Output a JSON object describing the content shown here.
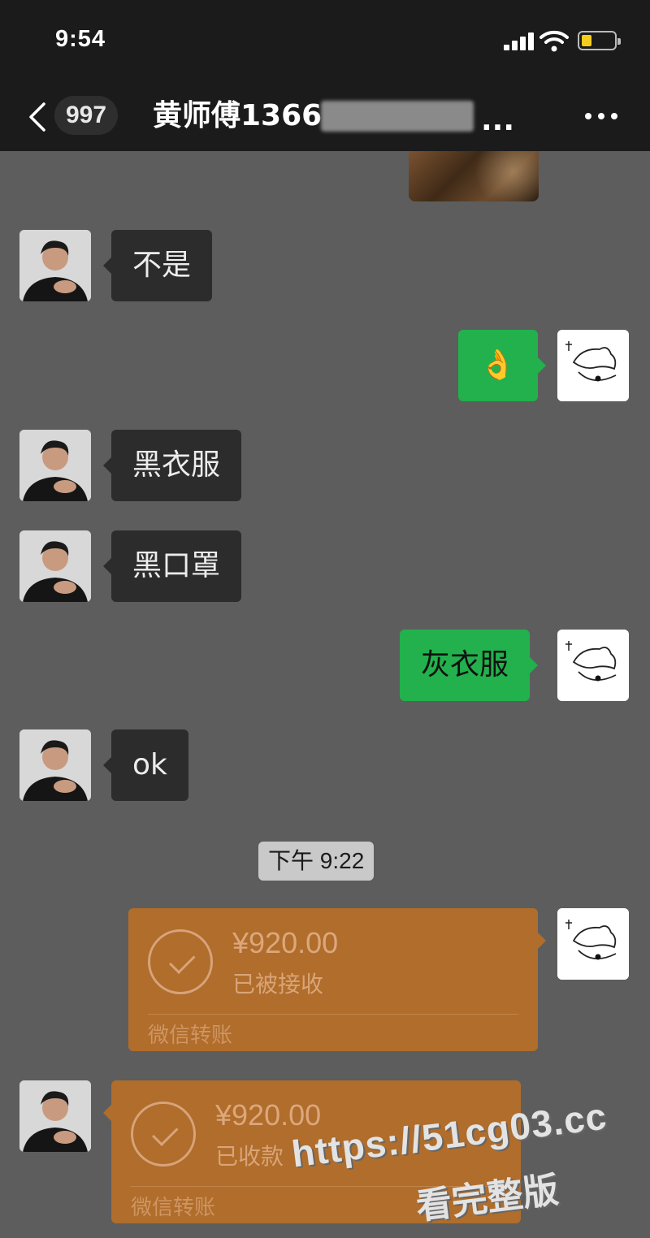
{
  "status_bar": {
    "time": "9:54"
  },
  "header": {
    "unread_count": "997",
    "title": "黄师傅1366",
    "title_ellipsis": "..."
  },
  "messages": [
    {
      "side": "left",
      "text": "不是"
    },
    {
      "side": "right",
      "text": "👌"
    },
    {
      "side": "left",
      "text": "黑衣服"
    },
    {
      "side": "left",
      "text": "黑口罩"
    },
    {
      "side": "right",
      "text": "灰衣服"
    },
    {
      "side": "left",
      "text": "ok"
    }
  ],
  "timestamp": "下午 9:22",
  "transfers": [
    {
      "side": "right",
      "amount": "¥920.00",
      "status": "已被接收",
      "label": "微信转账"
    },
    {
      "side": "left",
      "amount": "¥920.00",
      "status": "已收款",
      "label": "微信转账"
    }
  ],
  "watermark": {
    "url": "https://51cg03.cc",
    "text": "看完整版"
  },
  "colors": {
    "sent_bubble": "#22b14c",
    "received_bubble": "#2c2c2c",
    "transfer_card": "#b06d2b",
    "background": "#5d5d5d"
  }
}
